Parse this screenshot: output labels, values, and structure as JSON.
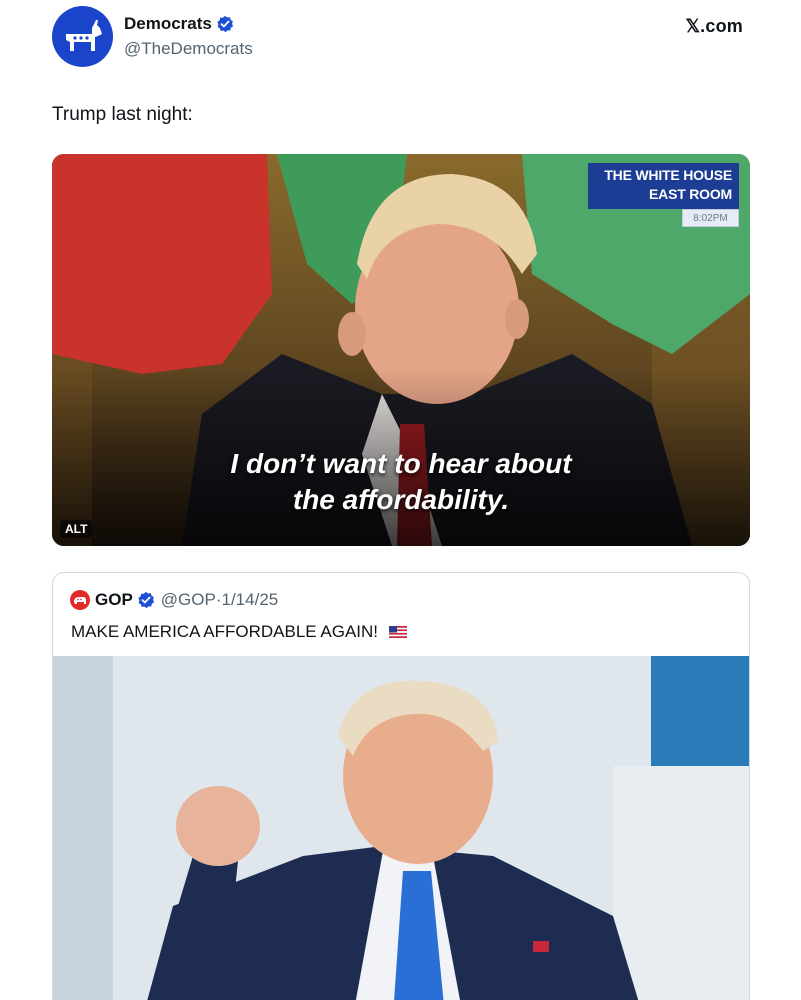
{
  "post": {
    "author": {
      "display_name": "Democrats",
      "handle": "@TheDemocrats",
      "verified": true,
      "avatar_icon": "donkey-logo"
    },
    "site_label": "𝕏.com",
    "text": "Trump last night:",
    "media": {
      "type": "video-still",
      "overlay_badge": {
        "line1": "THE WHITE HOUSE",
        "line2": "EAST ROOM",
        "time": "8:02PM"
      },
      "caption_line1": "I don’t want to hear about",
      "caption_line2": "the affordability.",
      "alt_label": "ALT"
    }
  },
  "quoted_post": {
    "author": {
      "display_name": "GOP",
      "handle": "@GOP",
      "verified": true,
      "avatar_icon": "elephant-logo"
    },
    "date_line": "·1/14/25",
    "text": "MAKE AMERICA AFFORDABLE AGAIN!",
    "emoji": "us-flag",
    "media": {
      "type": "photo"
    }
  },
  "colors": {
    "accent_blue": "#1a44c9",
    "verified_blue": "#1d4fd8",
    "gop_red": "#e12a2a",
    "muted_text": "#536471",
    "border": "#cfd9de"
  }
}
